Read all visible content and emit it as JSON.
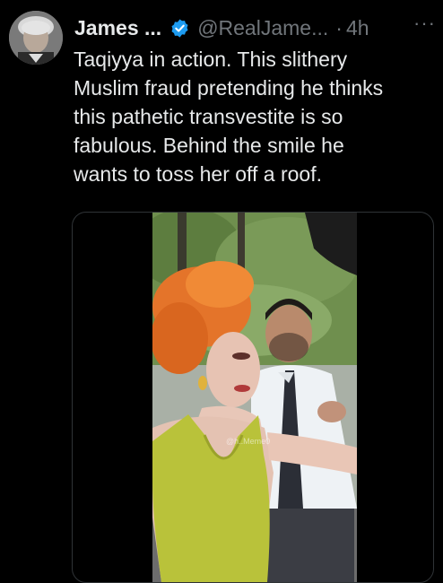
{
  "tweet": {
    "author_name": "James ...",
    "handle": "@RealJame...",
    "separator": "·",
    "time": "4h",
    "more_label": "···",
    "text_lines": [
      "Taqiyya in action. This slithery",
      "Muslim fraud pretending he thinks",
      "this pathetic transvestite is so",
      "fabulous. Behind the smile he",
      "wants to toss her off a roof."
    ],
    "verified_icon": "verified-badge-icon",
    "verified_color": "#1d9bf0"
  },
  "media": {
    "watermark": "@h..Meme0"
  },
  "theme": {
    "background": "#000000",
    "text_primary": "#e7e9ea",
    "text_secondary": "#71767b"
  }
}
